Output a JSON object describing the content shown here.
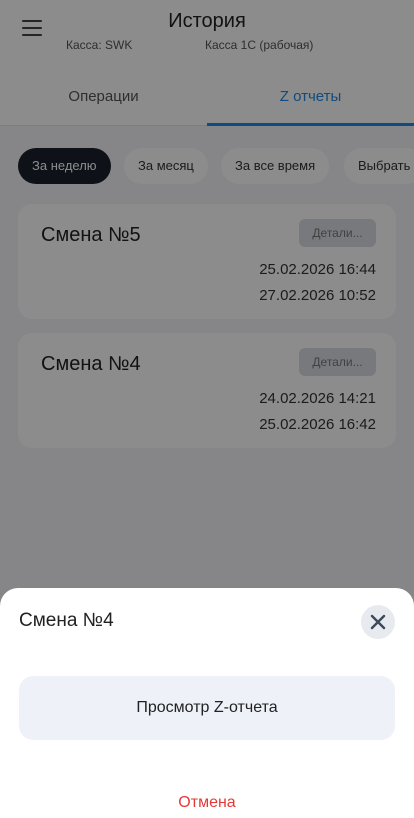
{
  "header": {
    "title": "История",
    "kassa_label": "Касса: SWK",
    "kassa_name": "Касса 1С (рабочая)"
  },
  "tabs": [
    {
      "label": "Операции"
    },
    {
      "label": "Z отчеты"
    }
  ],
  "filters": [
    {
      "label": "За неделю",
      "active": true
    },
    {
      "label": "За месяц"
    },
    {
      "label": "За все время"
    },
    {
      "label": "Выбрать"
    }
  ],
  "cards": [
    {
      "title": "Смена №5",
      "details_label": "Детали...",
      "opened": "25.02.2026 16:44",
      "closed": "27.02.2026 10:52"
    },
    {
      "title": "Смена №4",
      "details_label": "Детали...",
      "opened": "24.02.2026 14:21",
      "closed": "25.02.2026 16:42"
    }
  ],
  "sheet": {
    "title": "Смена №4",
    "action_label": "Просмотр Z-отчета",
    "cancel_label": "Отмена"
  },
  "colors": {
    "accent": "#1e88e5",
    "active_chip": "#1a1f2c",
    "cancel": "#e53935"
  }
}
